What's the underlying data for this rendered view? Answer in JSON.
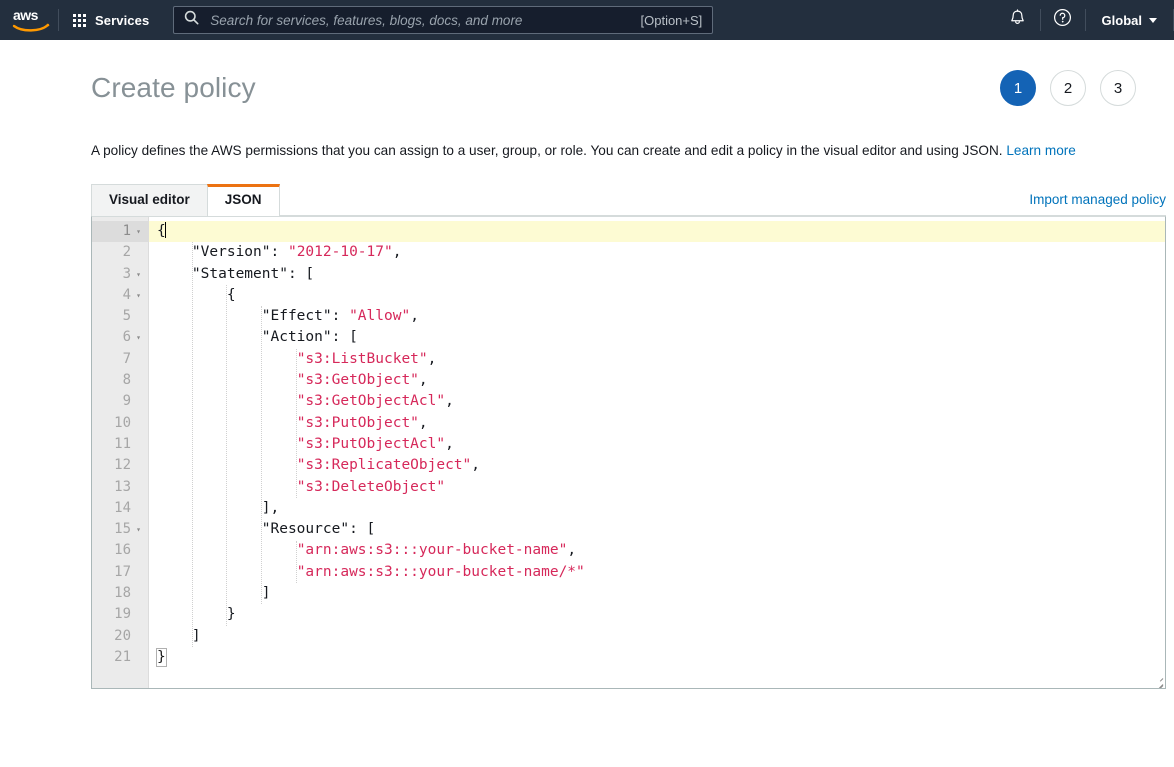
{
  "topnav": {
    "logo_alt": "aws",
    "services_label": "Services",
    "search": {
      "placeholder": "Search for services, features, blogs, docs, and more",
      "value": "",
      "shortcut": "[Option+S]"
    },
    "notifications_icon": "bell-icon",
    "help_icon": "help-circle-icon",
    "region_label": "Global"
  },
  "page": {
    "title": "Create policy",
    "steps": [
      {
        "label": "1",
        "active": true
      },
      {
        "label": "2",
        "active": false
      },
      {
        "label": "3",
        "active": false
      }
    ],
    "intro_text": "A policy defines the AWS permissions that you can assign to a user, group, or role. You can create and edit a policy in the visual editor and using JSON.",
    "intro_link": "Learn more",
    "import_link": "Import managed policy",
    "tabs": [
      {
        "label": "Visual editor",
        "active": false
      },
      {
        "label": "JSON",
        "active": true
      }
    ]
  },
  "editor": {
    "active_line": 1,
    "cursor_line": 1,
    "cursor_col": 2,
    "colors": {
      "string": "#d6285a",
      "key": "#16191f",
      "active_line_bg": "#fdfbd3",
      "gutter_bg": "#ebebeb"
    },
    "lines": [
      {
        "n": 1,
        "fold": true,
        "indent": 0,
        "text": "{",
        "type": "punct",
        "cursor": true,
        "active": true
      },
      {
        "n": 2,
        "fold": false,
        "indent": 1,
        "text": "\"Version\": \"2012-10-17\",",
        "type": "kv"
      },
      {
        "n": 3,
        "fold": true,
        "indent": 1,
        "text": "\"Statement\": [",
        "type": "kv"
      },
      {
        "n": 4,
        "fold": true,
        "indent": 2,
        "text": "{",
        "type": "punct"
      },
      {
        "n": 5,
        "fold": false,
        "indent": 3,
        "text": "\"Effect\": \"Allow\",",
        "type": "kv"
      },
      {
        "n": 6,
        "fold": true,
        "indent": 3,
        "text": "\"Action\": [",
        "type": "kv"
      },
      {
        "n": 7,
        "fold": false,
        "indent": 4,
        "text": "\"s3:ListBucket\",",
        "type": "str"
      },
      {
        "n": 8,
        "fold": false,
        "indent": 4,
        "text": "\"s3:GetObject\",",
        "type": "str"
      },
      {
        "n": 9,
        "fold": false,
        "indent": 4,
        "text": "\"s3:GetObjectAcl\",",
        "type": "str"
      },
      {
        "n": 10,
        "fold": false,
        "indent": 4,
        "text": "\"s3:PutObject\",",
        "type": "str"
      },
      {
        "n": 11,
        "fold": false,
        "indent": 4,
        "text": "\"s3:PutObjectAcl\",",
        "type": "str"
      },
      {
        "n": 12,
        "fold": false,
        "indent": 4,
        "text": "\"s3:ReplicateObject\",",
        "type": "str"
      },
      {
        "n": 13,
        "fold": false,
        "indent": 4,
        "text": "\"s3:DeleteObject\"",
        "type": "str"
      },
      {
        "n": 14,
        "fold": false,
        "indent": 3,
        "text": "],",
        "type": "punct"
      },
      {
        "n": 15,
        "fold": true,
        "indent": 3,
        "text": "\"Resource\": [",
        "type": "kv"
      },
      {
        "n": 16,
        "fold": false,
        "indent": 4,
        "text": "\"arn:aws:s3:::your-bucket-name\",",
        "type": "str"
      },
      {
        "n": 17,
        "fold": false,
        "indent": 4,
        "text": "\"arn:aws:s3:::your-bucket-name/*\"",
        "type": "str"
      },
      {
        "n": 18,
        "fold": false,
        "indent": 3,
        "text": "]",
        "type": "punct"
      },
      {
        "n": 19,
        "fold": false,
        "indent": 2,
        "text": "}",
        "type": "punct"
      },
      {
        "n": 20,
        "fold": false,
        "indent": 1,
        "text": "]",
        "type": "punct"
      },
      {
        "n": 21,
        "fold": false,
        "indent": 0,
        "text": "}",
        "type": "punct",
        "brace_match": true
      }
    ]
  }
}
